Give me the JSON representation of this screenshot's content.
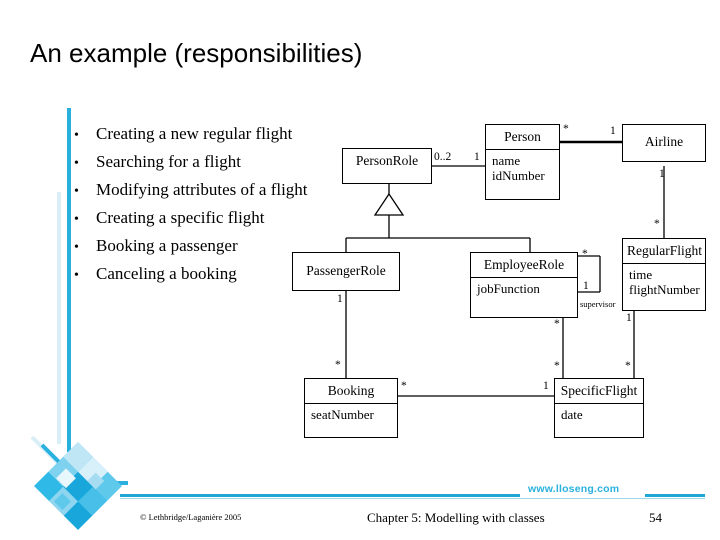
{
  "slide": {
    "title": "An example (responsibilities)"
  },
  "bullets": [
    {
      "marker": "•",
      "text": "Creating a new regular flight"
    },
    {
      "marker": "•",
      "text": "Searching for a flight"
    },
    {
      "marker": "•",
      "text": "Modifying attributes of a flight"
    },
    {
      "marker": "•",
      "text": "Creating a specific flight"
    },
    {
      "marker": "•",
      "text": "Booking a passenger"
    },
    {
      "marker": "•",
      "text": "Canceling a booking"
    }
  ],
  "diagram": {
    "type": "uml-class-diagram",
    "classes": [
      {
        "name": "PersonRole",
        "attributes": []
      },
      {
        "name": "Person",
        "attributes": [
          "name",
          "idNumber"
        ]
      },
      {
        "name": "Airline",
        "attributes": []
      },
      {
        "name": "PassengerRole",
        "attributes": []
      },
      {
        "name": "EmployeeRole",
        "attributes": [
          "jobFunction"
        ]
      },
      {
        "name": "RegularFlight",
        "attributes": [
          "time",
          "flightNumber"
        ]
      },
      {
        "name": "Booking",
        "attributes": [
          "seatNumber"
        ]
      },
      {
        "name": "SpecificFlight",
        "attributes": [
          "date"
        ]
      }
    ],
    "multiplicities": {
      "personrole_to_person": "0..2",
      "person_to_personrole": "1",
      "person_to_airline": "*",
      "airline_to_person": "1",
      "airline_to_regularflight": "1",
      "regularflight_to_airline": "*",
      "employeerole_supervisor_many": "*",
      "employeerole_supervisor_one": "1",
      "employeerole_to_specificflight_top": "*",
      "employeerole_to_specificflight_bottom": "*",
      "passengerrole_to_booking_one": "1",
      "booking_to_passengerrole_many": "*",
      "booking_to_specificflight": "*",
      "specificflight_to_booking": "1",
      "regularflight_to_specificflight_one": "1",
      "specificflight_to_regularflight_many": "*"
    },
    "association_roles": {
      "supervisor": "supervisor"
    }
  },
  "footer": {
    "copyright": "© Lethbridge/Laganière 2005",
    "chapter": "Chapter 5: Modelling with classes",
    "page": "54",
    "url": "www.lloseng.com"
  },
  "theme": {
    "accent_cyan": "#29b0dd",
    "accent_light": "#cfeaf5",
    "rule_blue": "#1ea7d4",
    "ink": "#000000",
    "page_bg": "#ffffff"
  }
}
